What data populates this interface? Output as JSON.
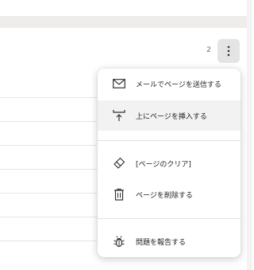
{
  "page": {
    "page_number": "2"
  },
  "more_button": {
    "icon": "more-vertical-icon"
  },
  "menu": {
    "items": [
      {
        "label": "メールでページを送信する",
        "icon": "mail-icon"
      },
      {
        "label": "上にページを挿入する",
        "icon": "insert-page-above-icon"
      },
      {
        "label": "[ページのクリア]",
        "icon": "eraser-icon"
      },
      {
        "label": "ページを削除する",
        "icon": "trash-icon"
      },
      {
        "label": "問題を報告する",
        "icon": "bug-icon"
      }
    ]
  }
}
